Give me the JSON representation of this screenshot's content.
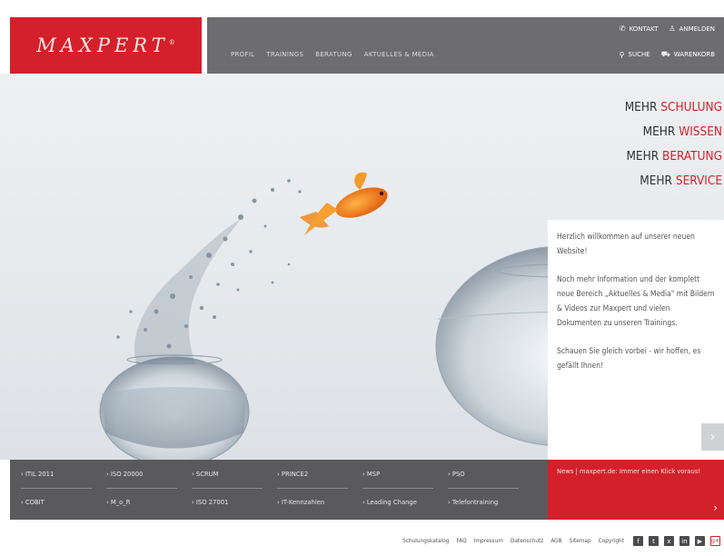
{
  "brand": {
    "logo_text": "MAXPERT",
    "reg_mark": "®"
  },
  "nav": {
    "items": [
      "PROFIL",
      "TRAININGS",
      "BERATUNG",
      "AKTUELLES & MEDIA"
    ]
  },
  "utility": {
    "kontakt": "KONTAKT",
    "anmelden": "ANMELDEN",
    "suche": "SUCHE",
    "warenkorb": "WARENKORB"
  },
  "hero": {
    "taglines": [
      {
        "prefix": "MEHR ",
        "highlight": "SCHULUNG"
      },
      {
        "prefix": "MEHR ",
        "highlight": "WISSEN"
      },
      {
        "prefix": "MEHR ",
        "highlight": "BERATUNG"
      },
      {
        "prefix": "MEHR ",
        "highlight": "SERVICE"
      }
    ],
    "welcome": [
      "Herzlich willkommen auf unserer neuen Website!",
      "Noch mehr Information und der komplett neue Bereich „Aktuelles & Media\" mit Bildern & Videos zur Maxpert und vielen Dokumenten zu unseren Trainings.",
      "Schauen Sie gleich vorbei - wir hoffen, es gefällt Ihnen!"
    ],
    "next_arrow": "›"
  },
  "quicklinks": {
    "row1": [
      "ITIL 2011",
      "ISO 20000",
      "SCRUM",
      "PRINCE2",
      "MSP",
      "PSO"
    ],
    "row2": [
      "COBIT",
      "M_o_R",
      "ISO 27001",
      "IT-Kennzahlen",
      "Leading Change",
      "Telefontraining"
    ]
  },
  "news": {
    "text": "News | maxpert.de: Immer einen Klick voraus!",
    "arrow": "›"
  },
  "footer": {
    "links": [
      "Schulungskatalog",
      "FAQ",
      "Impressum",
      "Datenschutz",
      "AGB",
      "Sitemap",
      "Copyright"
    ],
    "social": [
      {
        "icon": "facebook-icon",
        "glyph": "f"
      },
      {
        "icon": "twitter-icon",
        "glyph": "t"
      },
      {
        "icon": "xing-icon",
        "glyph": "x"
      },
      {
        "icon": "linkedin-icon",
        "glyph": "in"
      },
      {
        "icon": "youtube-icon",
        "glyph": "▶"
      },
      {
        "icon": "google-plus-icon",
        "glyph": "g+"
      }
    ]
  },
  "colors": {
    "brand_red": "#d4202a",
    "nav_grey": "#6d6d6f",
    "links_grey": "#5a5a5c"
  }
}
